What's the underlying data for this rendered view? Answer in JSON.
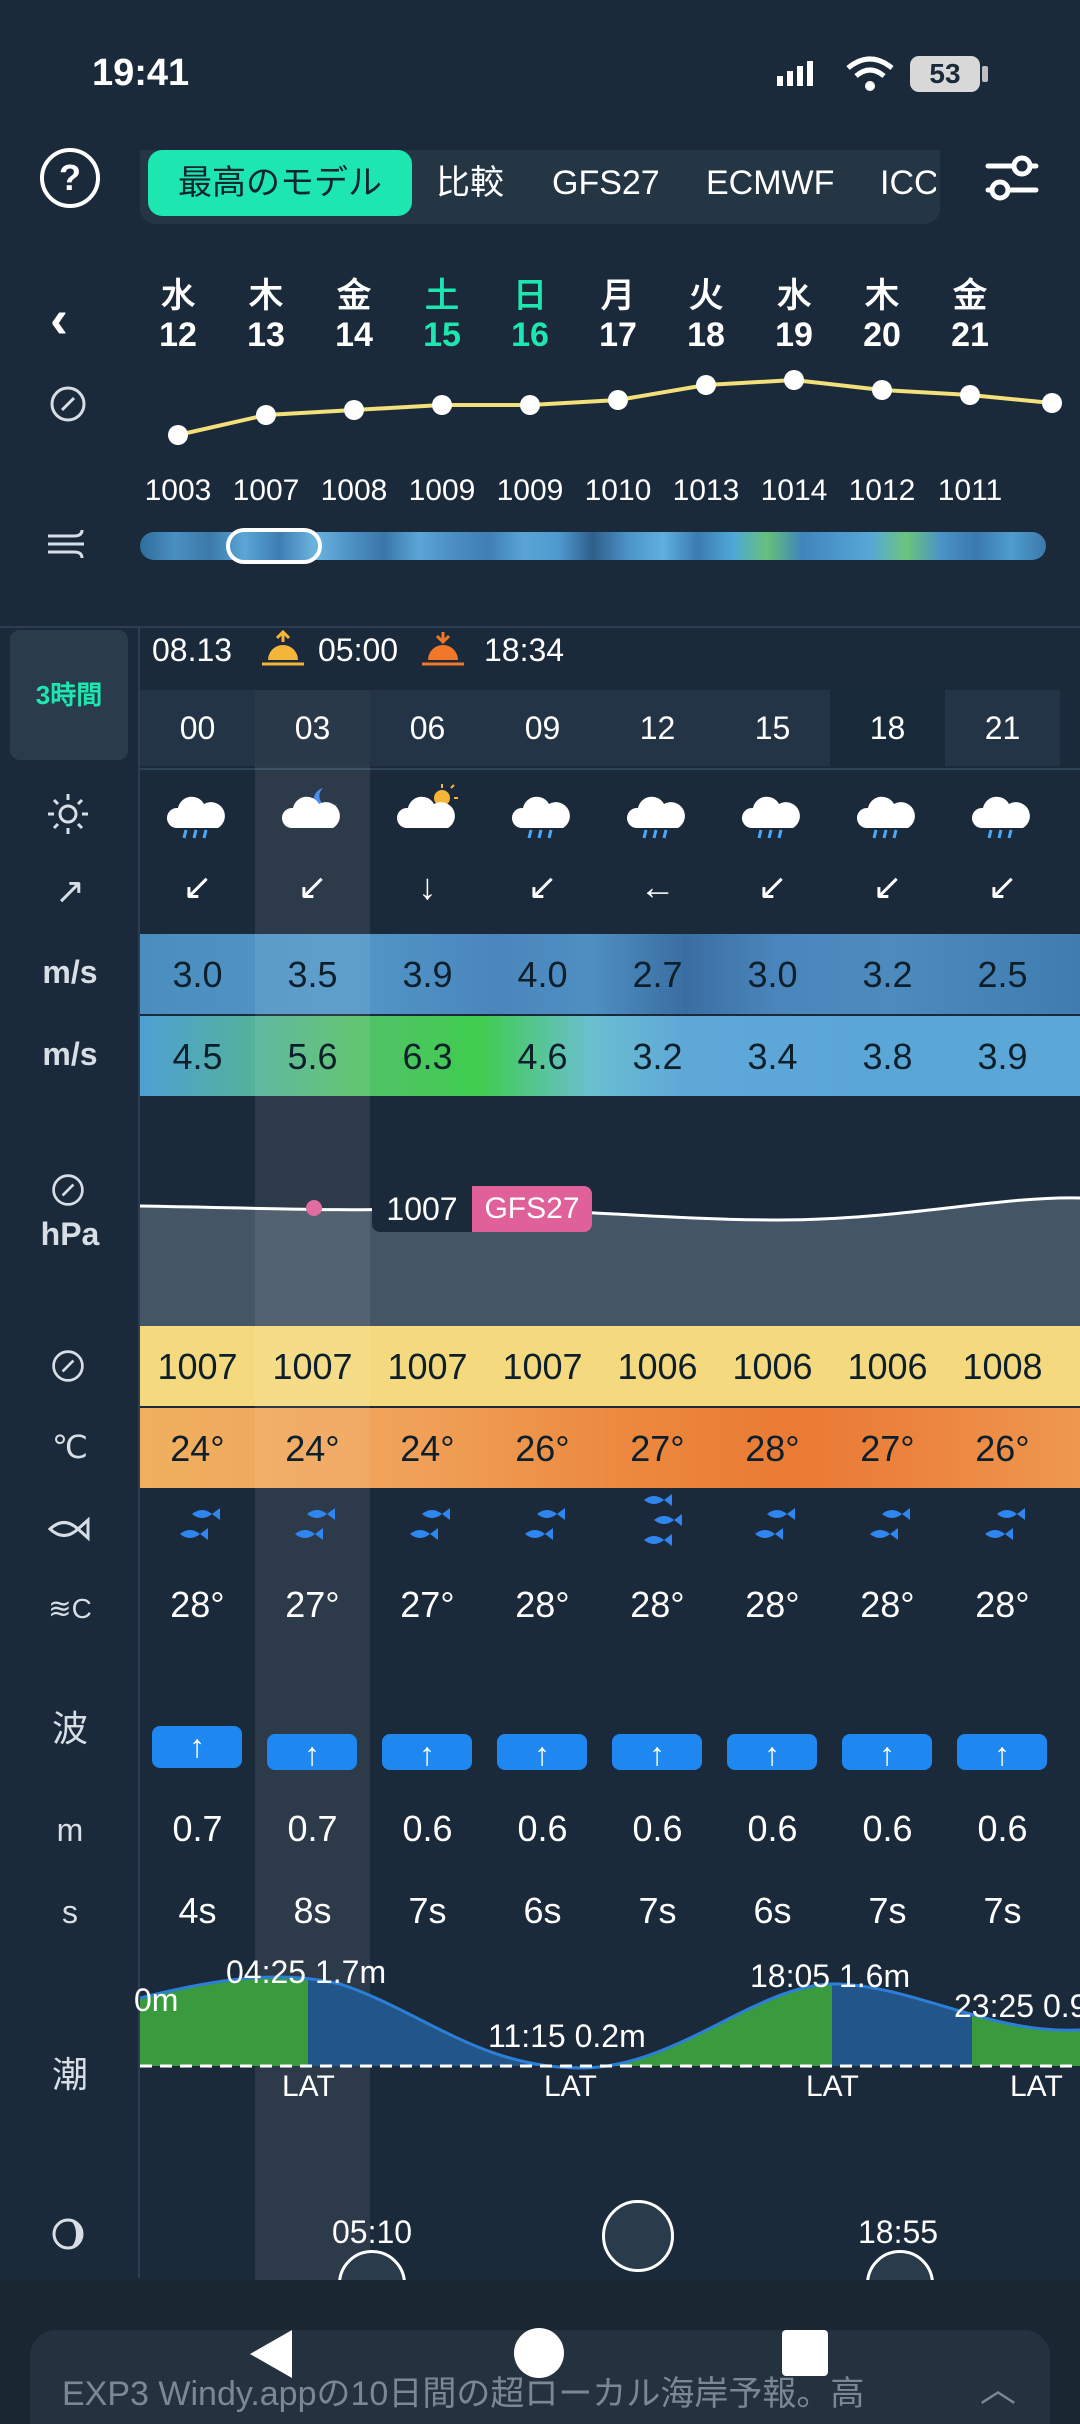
{
  "status": {
    "time": "19:41",
    "battery": "53"
  },
  "tabs": [
    "最高のモデル",
    "比較",
    "GFS27",
    "ECMWF",
    "ICC"
  ],
  "days": [
    {
      "name": "水",
      "num": "12",
      "weekend": false
    },
    {
      "name": "木",
      "num": "13",
      "weekend": false
    },
    {
      "name": "金",
      "num": "14",
      "weekend": false
    },
    {
      "name": "土",
      "num": "15",
      "weekend": true
    },
    {
      "name": "日",
      "num": "16",
      "weekend": true
    },
    {
      "name": "月",
      "num": "17",
      "weekend": false
    },
    {
      "name": "火",
      "num": "18",
      "weekend": false
    },
    {
      "name": "水",
      "num": "19",
      "weekend": false
    },
    {
      "name": "木",
      "num": "20",
      "weekend": false
    },
    {
      "name": "金",
      "num": "21",
      "weekend": false
    }
  ],
  "pressure_daily": [
    "1003",
    "1007",
    "1008",
    "1009",
    "1009",
    "1010",
    "1013",
    "1014",
    "1012",
    "1011"
  ],
  "forecast": {
    "interval": "3時間",
    "date": "08.13",
    "sunrise": "05:00",
    "sunset": "18:34",
    "hours": [
      "00",
      "03",
      "06",
      "09",
      "12",
      "15",
      "18",
      "21"
    ],
    "wind_speed_unit": "m/s",
    "gust_unit": "m/s",
    "wind_speed": [
      "3.0",
      "3.5",
      "3.9",
      "4.0",
      "2.7",
      "3.0",
      "3.2",
      "2.5"
    ],
    "wind_gust": [
      "4.5",
      "5.6",
      "6.3",
      "4.6",
      "3.2",
      "3.4",
      "3.8",
      "3.9"
    ],
    "wind_dir_glyphs": [
      "↙",
      "↙",
      "↓",
      "↙",
      "←",
      "↙",
      "↙",
      "↙"
    ],
    "pressure_unit": "hPa",
    "pressure_tooltip": "1007",
    "pressure_model": "GFS27",
    "pressure": [
      "1007",
      "1007",
      "1007",
      "1007",
      "1006",
      "1006",
      "1006",
      "1008"
    ],
    "temp_unit": "℃",
    "temperature": [
      "24°",
      "24°",
      "24°",
      "26°",
      "27°",
      "28°",
      "27°",
      "26°"
    ],
    "water_unit": "≋C",
    "water_temp": [
      "28°",
      "27°",
      "27°",
      "28°",
      "28°",
      "28°",
      "28°",
      "28°"
    ],
    "wave_label": "波",
    "wave_height_unit": "m",
    "wave_height": [
      "0.7",
      "0.7",
      "0.6",
      "0.6",
      "0.6",
      "0.6",
      "0.6",
      "0.6"
    ],
    "wave_period_unit": "s",
    "wave_period": [
      "4s",
      "8s",
      "7s",
      "6s",
      "7s",
      "6s",
      "7s",
      "7s"
    ],
    "tide_label": "潮",
    "tide_annotations": [
      "0m",
      "04:25 1.7m",
      "11:15 0.2m",
      "18:05 1.6m",
      "23:25 0.9"
    ],
    "tide_lat": "LAT",
    "moonrise": "05:10",
    "moonset": "18:55"
  },
  "ad": {
    "text": "EXP3 Windy.appの10日間の超ローカル海岸予報。高"
  },
  "colors": {
    "accent": "#1de6b0",
    "background": "#1b2a3a",
    "wave": "#1e88f0",
    "model_badge": "#e0609a"
  }
}
